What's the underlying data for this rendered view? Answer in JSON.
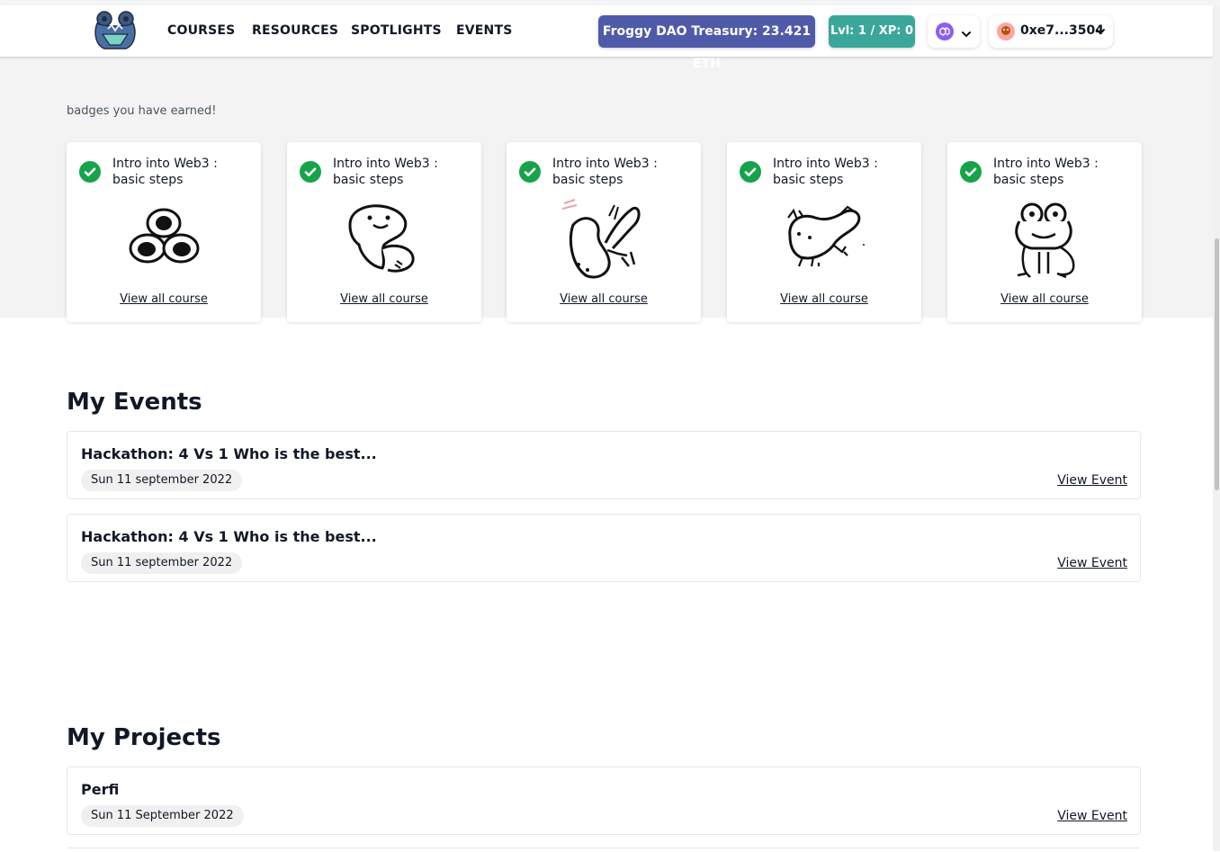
{
  "nav": {
    "links": [
      "COURSES",
      "RESOURCES",
      "SPOTLIGHTS",
      "EVENTS"
    ],
    "treasury": "Froggy DAO Treasury: 23.421 ETH",
    "level": "Lvl: 1 / XP: 0",
    "chain_icon": "polygon-icon",
    "account": "0xe7...3504",
    "logo_icon": "frog-logo-icon",
    "avatar_icon": "avatar-icon"
  },
  "badges": {
    "intro_text": "badges you have earned!",
    "cards": [
      {
        "title": "Intro into Web3 : basic steps",
        "link": "View all course",
        "art": "frog-eggs-icon"
      },
      {
        "title": "Intro into Web3 : basic steps",
        "link": "View all course",
        "art": "tadpole-icon"
      },
      {
        "title": "Intro into Web3 : basic steps",
        "link": "View all course",
        "art": "tadpole-legs-icon"
      },
      {
        "title": "Intro into Web3 : basic steps",
        "link": "View all course",
        "art": "froglet-icon"
      },
      {
        "title": "Intro into Web3 : basic steps",
        "link": "View all course",
        "art": "frog-icon"
      }
    ]
  },
  "events": {
    "title": "My Events",
    "items": [
      {
        "title": "Hackathon: 4 Vs 1 Who is the best...",
        "date": "Sun 11 september 2022",
        "link": "View Event"
      },
      {
        "title": "Hackathon: 4 Vs 1 Who is the best...",
        "date": "Sun 11 september 2022",
        "link": "View Event"
      }
    ]
  },
  "projects": {
    "title": "My Projects",
    "items": [
      {
        "title": "Perfi",
        "date": "Sun 11 September 2022",
        "link": "View Event"
      }
    ]
  },
  "colors": {
    "treasury": "#4f5ba8",
    "level": "#3aa79a",
    "check": "#16a34a"
  }
}
